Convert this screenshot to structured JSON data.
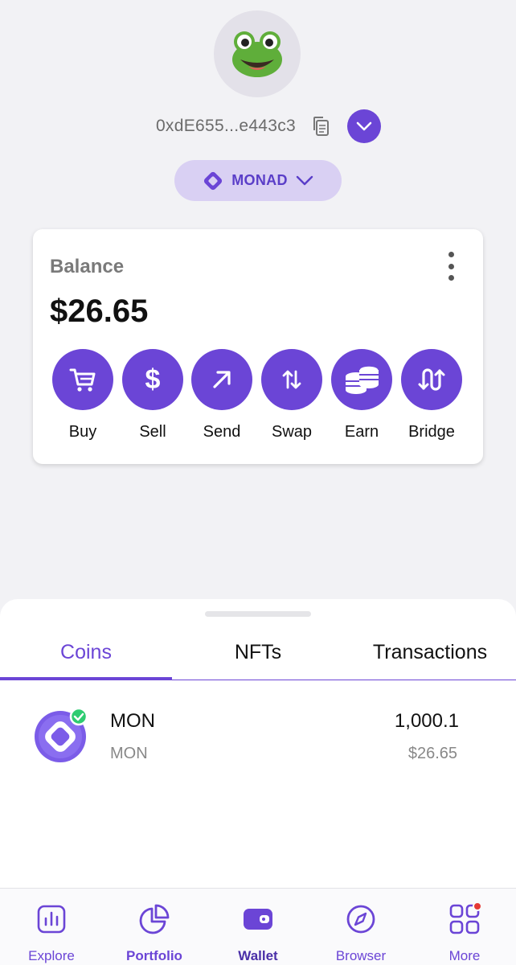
{
  "header": {
    "avatar_icon": "frog-emoji",
    "address": "0xdE655...e443c3",
    "copy_icon": "copy-icon",
    "account_toggle_icon": "chevron-down-icon"
  },
  "network": {
    "label": "MONAD",
    "icon": "monad-diamond-icon",
    "chevron": "chevron-down-icon"
  },
  "balance": {
    "label": "Balance",
    "value": "$26.65",
    "menu_icon": "more-vertical-icon"
  },
  "actions": [
    {
      "label": "Buy",
      "icon": "cart-icon"
    },
    {
      "label": "Sell",
      "icon": "dollar-icon"
    },
    {
      "label": "Send",
      "icon": "arrow-up-right-icon"
    },
    {
      "label": "Swap",
      "icon": "swap-vertical-icon"
    },
    {
      "label": "Earn",
      "icon": "coins-stack-icon"
    },
    {
      "label": "Bridge",
      "icon": "bridge-icon"
    }
  ],
  "tabs": [
    {
      "label": "Coins",
      "active": true
    },
    {
      "label": "NFTs",
      "active": false
    },
    {
      "label": "Transactions",
      "active": false
    }
  ],
  "coins": [
    {
      "name": "MON",
      "symbol": "MON",
      "amount": "1,000.1",
      "value": "$26.65",
      "verified": true
    }
  ],
  "nav": [
    {
      "label": "Explore",
      "icon": "bar-chart-icon"
    },
    {
      "label": "Portfolio",
      "icon": "pie-chart-icon"
    },
    {
      "label": "Wallet",
      "icon": "wallet-icon",
      "active": true
    },
    {
      "label": "Browser",
      "icon": "compass-icon"
    },
    {
      "label": "More",
      "icon": "grid-icon",
      "badge": true
    }
  ],
  "colors": {
    "accent": "#6b45d6",
    "background": "#f2f2f5",
    "pill": "#d9d0f3",
    "verified": "#2ecc71",
    "badge": "#e53935"
  }
}
